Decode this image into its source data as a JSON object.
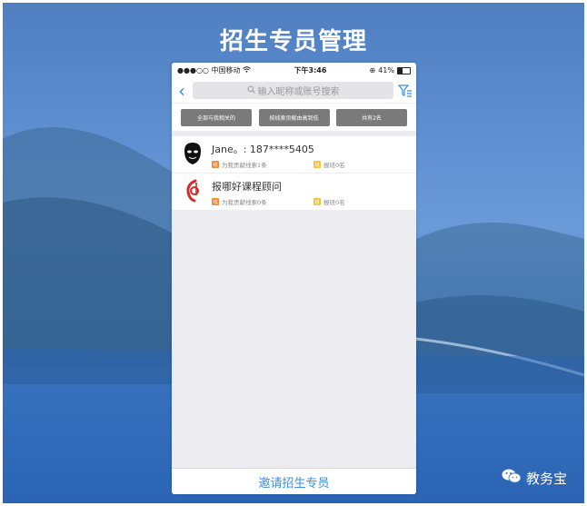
{
  "banner": {
    "title": "招生专员管理"
  },
  "status_bar": {
    "carrier": "●●●○○ 中国移动",
    "time": "下午3:46",
    "battery": "41%"
  },
  "nav": {
    "search_placeholder": "输入昵称或账号搜索"
  },
  "filters": [
    {
      "label": "全部与我相关的"
    },
    {
      "label": "按线索贡献由高到低"
    },
    {
      "label": "共有2名"
    }
  ],
  "list": [
    {
      "name": "Jane。: 187****5405",
      "leads": "为我贡献线索1条",
      "enrolled": "报班0名",
      "avatar_icon": "masked-face-avatar"
    },
    {
      "name": "报哪好课程顾问",
      "leads": "为我贡献线索0条",
      "enrolled": "报班0名",
      "avatar_icon": "red-logo-avatar"
    }
  ],
  "invite_button": "邀请招生专员",
  "watermark": "教务宝",
  "colors": {
    "accent": "#3a8ee6",
    "filter_button": "#7a7a7a",
    "tag_orange": "#f08c3a",
    "tag_yellow": "#f3c53d"
  }
}
